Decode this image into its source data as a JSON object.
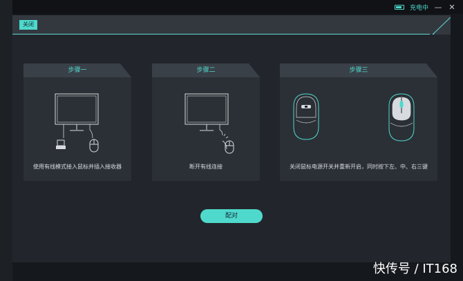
{
  "status": {
    "charging_label": "充电中"
  },
  "window": {
    "minimize_glyph": "—",
    "close_glyph": "✕"
  },
  "dialog": {
    "close_label": "关闭",
    "pair_label": "配对",
    "steps": [
      {
        "title": "步骤一",
        "text": "使用有线模式接入鼠标并插入接收器"
      },
      {
        "title": "步骤二",
        "text": "断开有线连接"
      },
      {
        "title": "步骤三",
        "text": "关闭鼠标电源开关并重新开启，同时按下左、中、右三键"
      }
    ]
  },
  "watermark": "快传号 / IT168",
  "colors": {
    "accent": "#4fd9cc",
    "panel": "#2b3036",
    "background": "#22262c"
  },
  "icons": [
    "battery-icon",
    "minimize-icon",
    "close-window-icon",
    "monitor-icon",
    "usb-receiver-icon",
    "mouse-icon"
  ]
}
